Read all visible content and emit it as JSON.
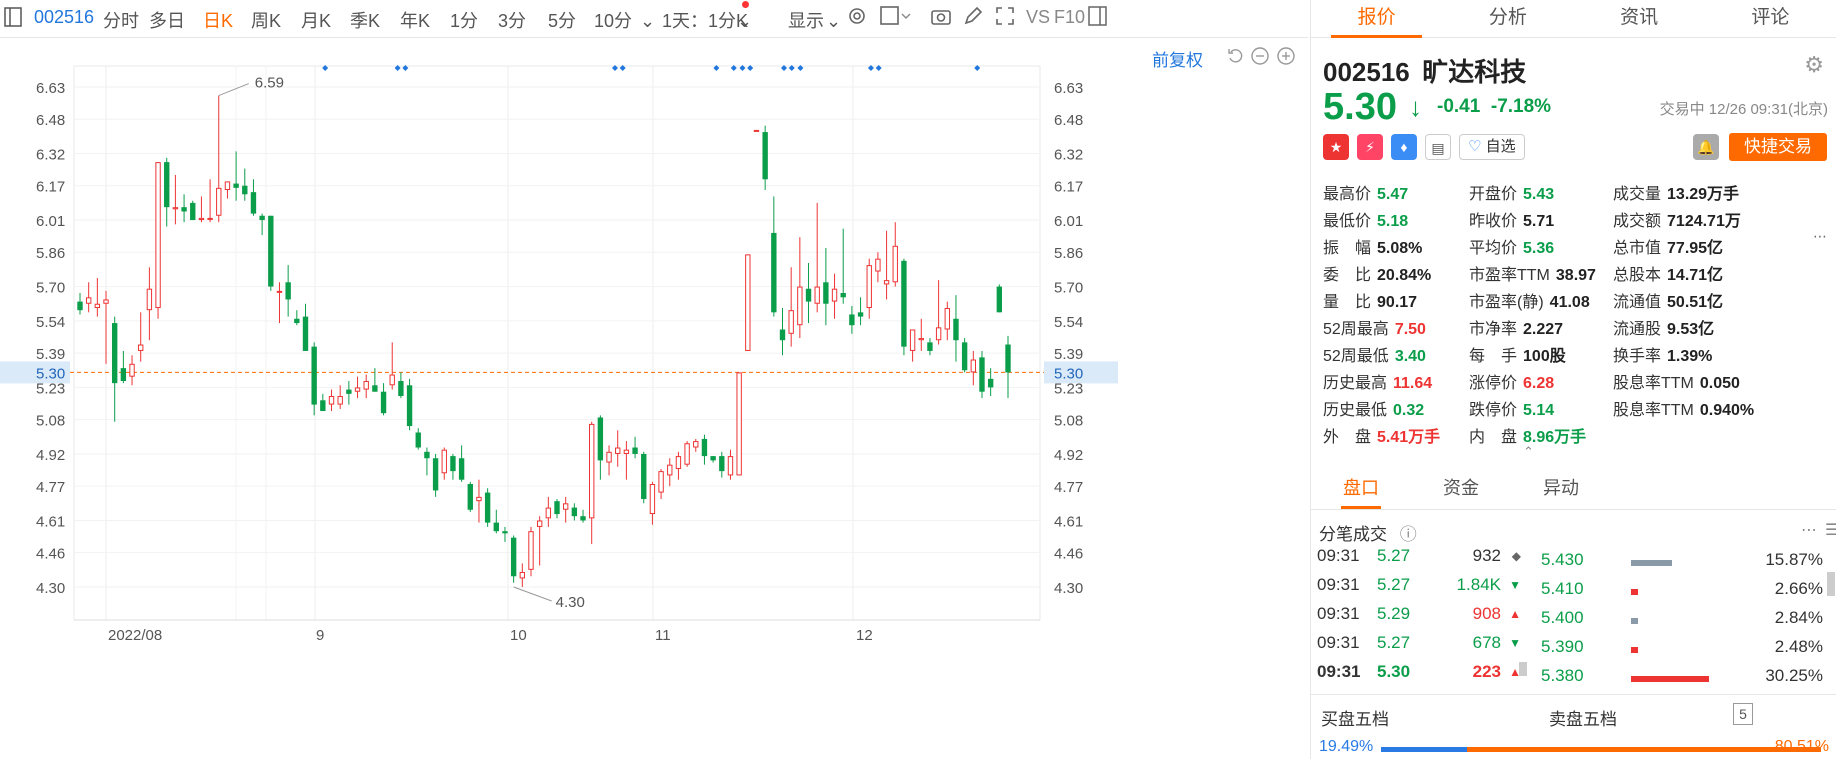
{
  "toolbar": {
    "code": "002516",
    "periods": [
      "分时",
      "多日",
      "日K",
      "周K",
      "月K",
      "季K",
      "年K",
      "1分",
      "3分",
      "5分",
      "10分"
    ],
    "active_period": "日K",
    "interval": "1天：1分K",
    "display": "显示",
    "vs": "VS",
    "f10": "F10"
  },
  "chart": {
    "fuquan": "前复权",
    "current_price_label": "5.30",
    "high_label": "6.59",
    "low_label": "4.30"
  },
  "chart_data": {
    "type": "candlestick",
    "y_ticks": [
      "6.63",
      "6.48",
      "6.32",
      "6.17",
      "6.01",
      "5.86",
      "5.70",
      "5.54",
      "5.39",
      "5.23",
      "5.08",
      "4.92",
      "4.77",
      "4.61",
      "4.46",
      "4.30"
    ],
    "x_ticks": [
      "2022/08",
      "9",
      "10",
      "11",
      "12"
    ],
    "ylim": [
      4.21,
      6.73
    ],
    "current_line": 5.3,
    "candles": [
      {
        "o": 5.63,
        "h": 5.67,
        "l": 5.57,
        "c": 5.59
      },
      {
        "o": 5.62,
        "h": 5.72,
        "l": 5.58,
        "c": 5.65
      },
      {
        "o": 5.6,
        "h": 5.74,
        "l": 5.56,
        "c": 5.62
      },
      {
        "o": 5.62,
        "h": 5.68,
        "l": 5.34,
        "c": 5.64
      },
      {
        "o": 5.53,
        "h": 5.56,
        "l": 5.07,
        "c": 5.25
      },
      {
        "o": 5.32,
        "h": 5.4,
        "l": 5.25,
        "c": 5.26
      },
      {
        "o": 5.28,
        "h": 5.38,
        "l": 5.24,
        "c": 5.34
      },
      {
        "o": 5.4,
        "h": 5.58,
        "l": 5.35,
        "c": 5.43
      },
      {
        "o": 5.59,
        "h": 5.79,
        "l": 5.45,
        "c": 5.69
      },
      {
        "o": 5.6,
        "h": 6.28,
        "l": 5.55,
        "c": 6.28
      },
      {
        "o": 6.28,
        "h": 6.3,
        "l": 5.98,
        "c": 6.07
      },
      {
        "o": 6.06,
        "h": 6.22,
        "l": 5.99,
        "c": 6.07
      },
      {
        "o": 6.07,
        "h": 6.13,
        "l": 6.0,
        "c": 6.05
      },
      {
        "o": 6.09,
        "h": 6.1,
        "l": 6.01,
        "c": 6.01
      },
      {
        "o": 6.01,
        "h": 6.12,
        "l": 6.0,
        "c": 6.02
      },
      {
        "o": 6.02,
        "h": 6.2,
        "l": 6.0,
        "c": 6.02
      },
      {
        "o": 6.03,
        "h": 6.59,
        "l": 6.0,
        "c": 6.16
      },
      {
        "o": 6.15,
        "h": 6.19,
        "l": 6.11,
        "c": 6.19
      },
      {
        "o": 6.18,
        "h": 6.33,
        "l": 6.1,
        "c": 6.16
      },
      {
        "o": 6.17,
        "h": 6.25,
        "l": 6.1,
        "c": 6.13
      },
      {
        "o": 6.14,
        "h": 6.2,
        "l": 6.03,
        "c": 6.04
      },
      {
        "o": 6.03,
        "h": 6.04,
        "l": 5.94,
        "c": 6.01
      },
      {
        "o": 6.03,
        "h": 6.03,
        "l": 5.68,
        "c": 5.7
      },
      {
        "o": 5.68,
        "h": 5.72,
        "l": 5.53,
        "c": 5.68
      },
      {
        "o": 5.72,
        "h": 5.8,
        "l": 5.56,
        "c": 5.64
      },
      {
        "o": 5.55,
        "h": 5.59,
        "l": 5.52,
        "c": 5.53
      },
      {
        "o": 5.56,
        "h": 5.62,
        "l": 5.4,
        "c": 5.4
      },
      {
        "o": 5.42,
        "h": 5.44,
        "l": 5.1,
        "c": 5.15
      },
      {
        "o": 5.17,
        "h": 5.2,
        "l": 5.12,
        "c": 5.12
      },
      {
        "o": 5.15,
        "h": 5.22,
        "l": 5.12,
        "c": 5.19
      },
      {
        "o": 5.15,
        "h": 5.24,
        "l": 5.13,
        "c": 5.19
      },
      {
        "o": 5.22,
        "h": 5.26,
        "l": 5.15,
        "c": 5.2
      },
      {
        "o": 5.21,
        "h": 5.28,
        "l": 5.18,
        "c": 5.23
      },
      {
        "o": 5.22,
        "h": 5.29,
        "l": 5.18,
        "c": 5.26
      },
      {
        "o": 5.24,
        "h": 5.32,
        "l": 5.21,
        "c": 5.21
      },
      {
        "o": 5.21,
        "h": 5.25,
        "l": 5.1,
        "c": 5.11
      },
      {
        "o": 5.24,
        "h": 5.44,
        "l": 5.22,
        "c": 5.29
      },
      {
        "o": 5.26,
        "h": 5.3,
        "l": 5.18,
        "c": 5.19
      },
      {
        "o": 5.24,
        "h": 5.27,
        "l": 5.03,
        "c": 5.05
      },
      {
        "o": 5.02,
        "h": 5.04,
        "l": 4.94,
        "c": 4.95
      },
      {
        "o": 4.93,
        "h": 4.95,
        "l": 4.82,
        "c": 4.9
      },
      {
        "o": 4.9,
        "h": 4.92,
        "l": 4.72,
        "c": 4.75
      },
      {
        "o": 4.83,
        "h": 4.95,
        "l": 4.8,
        "c": 4.94
      },
      {
        "o": 4.91,
        "h": 4.92,
        "l": 4.8,
        "c": 4.84
      },
      {
        "o": 4.9,
        "h": 4.96,
        "l": 4.79,
        "c": 4.8
      },
      {
        "o": 4.78,
        "h": 4.79,
        "l": 4.65,
        "c": 4.66
      },
      {
        "o": 4.7,
        "h": 4.8,
        "l": 4.6,
        "c": 4.72
      },
      {
        "o": 4.74,
        "h": 4.76,
        "l": 4.58,
        "c": 4.6
      },
      {
        "o": 4.6,
        "h": 4.66,
        "l": 4.55,
        "c": 4.56
      },
      {
        "o": 4.56,
        "h": 4.58,
        "l": 4.51,
        "c": 4.55
      },
      {
        "o": 4.53,
        "h": 4.54,
        "l": 4.32,
        "c": 4.35
      },
      {
        "o": 4.34,
        "h": 4.41,
        "l": 4.3,
        "c": 4.37
      },
      {
        "o": 4.38,
        "h": 4.58,
        "l": 4.35,
        "c": 4.56
      },
      {
        "o": 4.58,
        "h": 4.63,
        "l": 4.4,
        "c": 4.61
      },
      {
        "o": 4.62,
        "h": 4.72,
        "l": 4.58,
        "c": 4.67
      },
      {
        "o": 4.7,
        "h": 4.71,
        "l": 4.62,
        "c": 4.64
      },
      {
        "o": 4.66,
        "h": 4.72,
        "l": 4.6,
        "c": 4.69
      },
      {
        "o": 4.67,
        "h": 4.69,
        "l": 4.61,
        "c": 4.63
      },
      {
        "o": 4.63,
        "h": 4.66,
        "l": 4.6,
        "c": 4.61
      },
      {
        "o": 4.62,
        "h": 5.07,
        "l": 4.5,
        "c": 5.06
      },
      {
        "o": 5.09,
        "h": 5.1,
        "l": 4.8,
        "c": 4.89
      },
      {
        "o": 4.88,
        "h": 4.96,
        "l": 4.82,
        "c": 4.93
      },
      {
        "o": 4.92,
        "h": 5.03,
        "l": 4.86,
        "c": 4.95
      },
      {
        "o": 4.92,
        "h": 4.98,
        "l": 4.8,
        "c": 4.94
      },
      {
        "o": 4.95,
        "h": 5.0,
        "l": 4.9,
        "c": 4.92
      },
      {
        "o": 4.92,
        "h": 4.93,
        "l": 4.69,
        "c": 4.71
      },
      {
        "o": 4.64,
        "h": 4.79,
        "l": 4.59,
        "c": 4.78
      },
      {
        "o": 4.74,
        "h": 4.85,
        "l": 4.71,
        "c": 4.84
      },
      {
        "o": 4.82,
        "h": 4.9,
        "l": 4.77,
        "c": 4.87
      },
      {
        "o": 4.85,
        "h": 4.93,
        "l": 4.8,
        "c": 4.91
      },
      {
        "o": 4.87,
        "h": 4.98,
        "l": 4.86,
        "c": 4.97
      },
      {
        "o": 4.95,
        "h": 4.99,
        "l": 4.93,
        "c": 4.98
      },
      {
        "o": 4.99,
        "h": 5.01,
        "l": 4.87,
        "c": 4.91
      },
      {
        "o": 4.91,
        "h": 4.91,
        "l": 4.88,
        "c": 4.89
      },
      {
        "o": 4.91,
        "h": 4.93,
        "l": 4.81,
        "c": 4.84
      },
      {
        "o": 4.82,
        "h": 4.94,
        "l": 4.8,
        "c": 4.91
      },
      {
        "o": 4.82,
        "h": 5.3,
        "l": 4.82,
        "c": 5.3
      },
      {
        "o": 5.4,
        "h": 5.85,
        "l": 5.4,
        "c": 5.85
      },
      {
        "o": 6.43,
        "h": 6.43,
        "l": 6.43,
        "c": 6.43
      },
      {
        "o": 6.42,
        "h": 6.45,
        "l": 6.15,
        "c": 6.2
      },
      {
        "o": 5.95,
        "h": 6.12,
        "l": 5.56,
        "c": 5.58
      },
      {
        "o": 5.5,
        "h": 5.6,
        "l": 5.38,
        "c": 5.45
      },
      {
        "o": 5.48,
        "h": 5.79,
        "l": 5.42,
        "c": 5.59
      },
      {
        "o": 5.52,
        "h": 5.93,
        "l": 5.46,
        "c": 5.7
      },
      {
        "o": 5.69,
        "h": 5.81,
        "l": 5.53,
        "c": 5.63
      },
      {
        "o": 5.62,
        "h": 6.09,
        "l": 5.58,
        "c": 5.7
      },
      {
        "o": 5.72,
        "h": 5.88,
        "l": 5.52,
        "c": 5.62
      },
      {
        "o": 5.63,
        "h": 5.76,
        "l": 5.55,
        "c": 5.69
      },
      {
        "o": 5.67,
        "h": 5.97,
        "l": 5.62,
        "c": 5.65
      },
      {
        "o": 5.57,
        "h": 5.61,
        "l": 5.48,
        "c": 5.52
      },
      {
        "o": 5.58,
        "h": 5.65,
        "l": 5.52,
        "c": 5.56
      },
      {
        "o": 5.6,
        "h": 5.83,
        "l": 5.55,
        "c": 5.8
      },
      {
        "o": 5.77,
        "h": 5.86,
        "l": 5.72,
        "c": 5.83
      },
      {
        "o": 5.71,
        "h": 5.96,
        "l": 5.64,
        "c": 5.73
      },
      {
        "o": 5.72,
        "h": 6.0,
        "l": 5.7,
        "c": 5.89
      },
      {
        "o": 5.82,
        "h": 5.83,
        "l": 5.38,
        "c": 5.42
      },
      {
        "o": 5.4,
        "h": 5.5,
        "l": 5.35,
        "c": 5.5
      },
      {
        "o": 5.45,
        "h": 5.55,
        "l": 5.4,
        "c": 5.46
      },
      {
        "o": 5.44,
        "h": 5.46,
        "l": 5.38,
        "c": 5.4
      },
      {
        "o": 5.45,
        "h": 5.73,
        "l": 5.43,
        "c": 5.51
      },
      {
        "o": 5.5,
        "h": 5.63,
        "l": 5.45,
        "c": 5.6
      },
      {
        "o": 5.55,
        "h": 5.66,
        "l": 5.35,
        "c": 5.45
      },
      {
        "o": 5.44,
        "h": 5.46,
        "l": 5.3,
        "c": 5.31
      },
      {
        "o": 5.3,
        "h": 5.4,
        "l": 5.24,
        "c": 5.36
      },
      {
        "o": 5.37,
        "h": 5.4,
        "l": 5.18,
        "c": 5.21
      },
      {
        "o": 5.27,
        "h": 5.32,
        "l": 5.19,
        "c": 5.23
      },
      {
        "o": 5.7,
        "h": 5.71,
        "l": 5.58,
        "c": 5.58
      },
      {
        "o": 5.43,
        "h": 5.47,
        "l": 5.18,
        "c": 5.3
      }
    ],
    "event_markers": [
      0.26,
      0.335,
      0.343,
      0.56,
      0.568,
      0.665,
      0.683,
      0.692,
      0.7,
      0.735,
      0.743,
      0.752,
      0.825,
      0.833,
      0.935
    ]
  },
  "quote": {
    "tabs": [
      "报价",
      "分析",
      "资讯",
      "评论"
    ],
    "code": "002516",
    "name": "旷达科技",
    "price": "5.30",
    "change": "-0.41",
    "change_pct": "-7.18%",
    "trade_time": "交易中 12/26 09:31(北京)",
    "watchlist": "自选",
    "quick_trade": "快捷交易",
    "stats": [
      [
        {
          "l": "最高价",
          "v": "5.47",
          "c": "green"
        },
        {
          "l": "开盘价",
          "v": "5.43",
          "c": "green"
        },
        {
          "l": "成交量",
          "v": "13.29万手",
          "c": ""
        }
      ],
      [
        {
          "l": "最低价",
          "v": "5.18",
          "c": "green"
        },
        {
          "l": "昨收价",
          "v": "5.71",
          "c": ""
        },
        {
          "l": "成交额",
          "v": "7124.71万",
          "c": ""
        }
      ],
      [
        {
          "l": "振　幅",
          "v": "5.08%",
          "c": ""
        },
        {
          "l": "平均价",
          "v": "5.36",
          "c": "green"
        },
        {
          "l": "总市值",
          "v": "77.95亿",
          "c": ""
        }
      ],
      [
        {
          "l": "委　比",
          "v": "20.84%",
          "c": ""
        },
        {
          "l": "市盈率TTM",
          "v": "38.97",
          "c": ""
        },
        {
          "l": "总股本",
          "v": "14.71亿",
          "c": ""
        }
      ],
      [
        {
          "l": "量　比",
          "v": "90.17",
          "c": ""
        },
        {
          "l": "市盈率(静)",
          "v": "41.08",
          "c": ""
        },
        {
          "l": "流通值",
          "v": "50.51亿",
          "c": ""
        }
      ],
      [
        {
          "l": "52周最高",
          "v": "7.50",
          "c": "red"
        },
        {
          "l": "市净率",
          "v": "2.227",
          "c": ""
        },
        {
          "l": "流通股",
          "v": "9.53亿",
          "c": ""
        }
      ],
      [
        {
          "l": "52周最低",
          "v": "3.40",
          "c": "green"
        },
        {
          "l": "每　手",
          "v": "100股",
          "c": ""
        },
        {
          "l": "换手率",
          "v": "1.39%",
          "c": ""
        }
      ],
      [
        {
          "l": "历史最高",
          "v": "11.64",
          "c": "red"
        },
        {
          "l": "涨停价",
          "v": "6.28",
          "c": "red"
        },
        {
          "l": "股息率TTM",
          "v": "0.050",
          "c": ""
        }
      ],
      [
        {
          "l": "历史最低",
          "v": "0.32",
          "c": "green"
        },
        {
          "l": "跌停价",
          "v": "5.14",
          "c": "green"
        },
        {
          "l": "股息率TTM",
          "v": "0.940%",
          "c": ""
        }
      ],
      [
        {
          "l": "外　盘",
          "v": "5.41万手",
          "c": "red"
        },
        {
          "l": "内　盘",
          "v": "8.96万手",
          "c": "green"
        },
        {
          "l": "",
          "v": "",
          "c": ""
        }
      ]
    ],
    "subtabs": [
      "盘口",
      "资金",
      "异动"
    ],
    "ticks_title": "分笔成交",
    "ticks": [
      {
        "t": "09:31",
        "p": "5.27",
        "v": "932",
        "d": "flat"
      },
      {
        "t": "09:31",
        "p": "5.27",
        "v": "1.84K",
        "d": "down"
      },
      {
        "t": "09:31",
        "p": "5.29",
        "v": "908",
        "d": "up"
      },
      {
        "t": "09:31",
        "p": "5.27",
        "v": "678",
        "d": "down"
      },
      {
        "t": "09:31",
        "p": "5.30",
        "v": "223",
        "d": "up"
      }
    ],
    "book": [
      {
        "p": "5.430",
        "pct": "15.87%",
        "frac": 0.159,
        "color": "#8a9aa8"
      },
      {
        "p": "5.410",
        "pct": "2.66%",
        "frac": 0.027,
        "color": "#e33"
      },
      {
        "p": "5.400",
        "pct": "2.84%",
        "frac": 0.028,
        "color": "#8a9aa8"
      },
      {
        "p": "5.390",
        "pct": "2.48%",
        "frac": 0.025,
        "color": "#e33"
      },
      {
        "p": "5.380",
        "pct": "30.25%",
        "frac": 0.3,
        "color": "#e33"
      }
    ],
    "buy_label": "买盘五档",
    "sell_label": "卖盘五档",
    "five": "5",
    "buy_pct": "19.49%",
    "sell_pct": "80.51%",
    "buy_frac": 0.1949,
    "colors": {
      "up": "#e33",
      "down": "#0b9e4a",
      "accent": "#ff6a00",
      "link": "#2277dd"
    }
  }
}
